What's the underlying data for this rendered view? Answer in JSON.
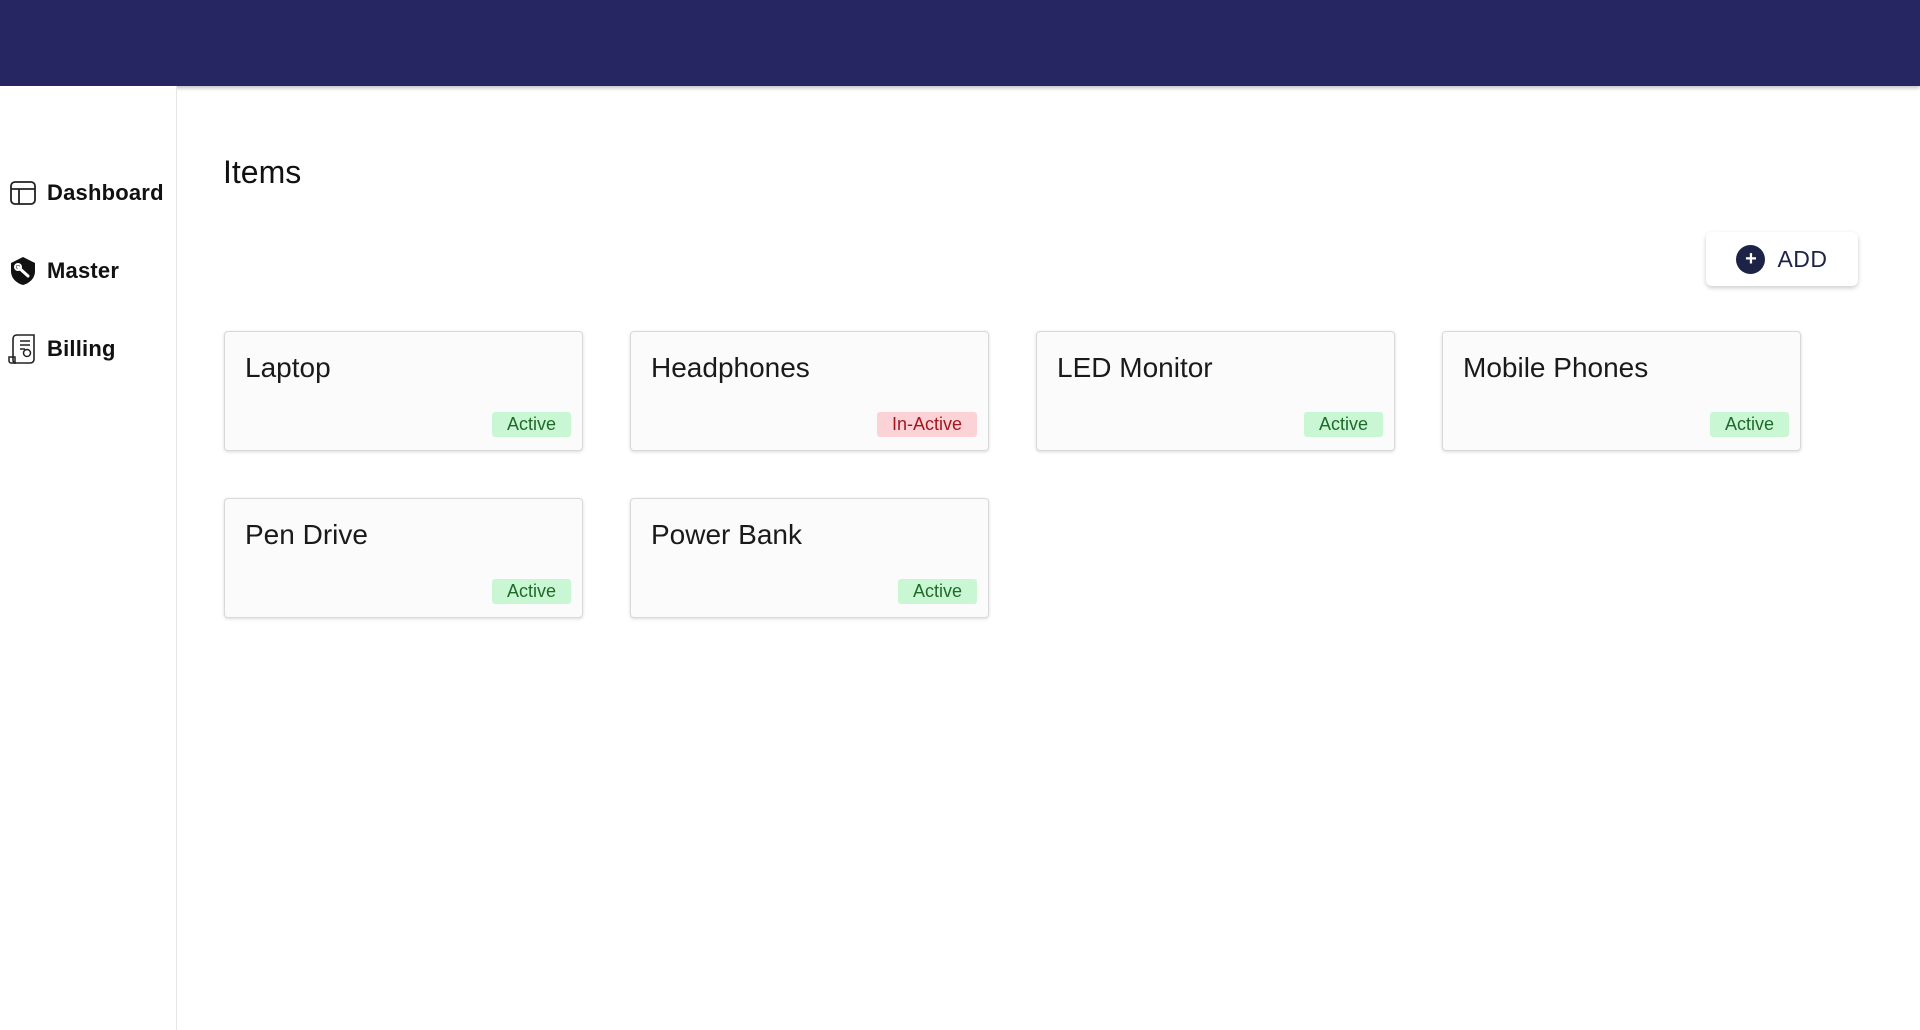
{
  "sidebar": {
    "items": [
      {
        "label": "Dashboard",
        "icon": "dashboard-icon"
      },
      {
        "label": "Master",
        "icon": "master-icon"
      },
      {
        "label": "Billing",
        "icon": "billing-icon"
      }
    ]
  },
  "main": {
    "title": "Items",
    "add_button": {
      "label": "ADD",
      "icon_text": "+"
    },
    "items": [
      {
        "name": "Laptop",
        "status": "Active"
      },
      {
        "name": "Headphones",
        "status": "In-Active"
      },
      {
        "name": "LED Monitor",
        "status": "Active"
      },
      {
        "name": "Mobile Phones",
        "status": "Active"
      },
      {
        "name": "Pen Drive",
        "status": "Active"
      },
      {
        "name": "Power Bank",
        "status": "Active"
      }
    ]
  },
  "colors": {
    "header": "#262662",
    "active_badge_bg": "#c9f7d3",
    "active_badge_text": "#1f6a2a",
    "inactive_badge_bg": "#fbd3d6",
    "inactive_badge_text": "#a31620",
    "add_icon": "#1d2247"
  }
}
